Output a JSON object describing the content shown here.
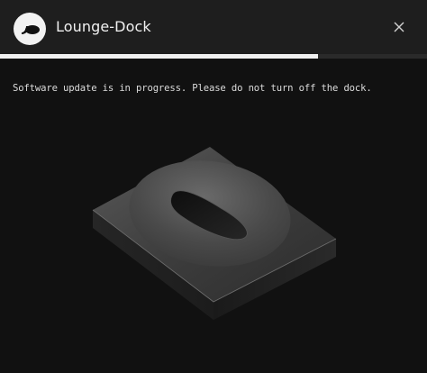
{
  "window": {
    "title": "Lounge-Dock",
    "logo_icon": "lounge-dock-logo",
    "close_icon": "close-icon"
  },
  "update": {
    "progress": 0.745,
    "message": "Software update is in progress. Please do not turn off the dock."
  },
  "colors": {
    "background": "#111111",
    "titlebar": "#1e1e1e",
    "progress": "#f0f0f0",
    "progress_track": "#2a2a2a"
  }
}
